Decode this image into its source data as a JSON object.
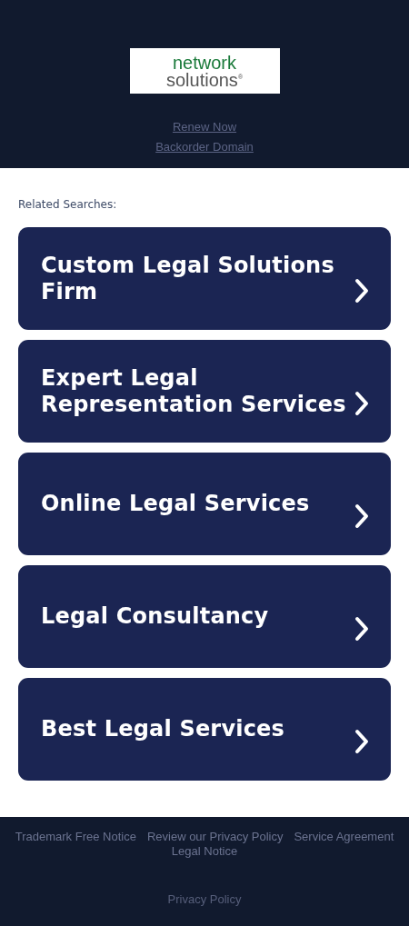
{
  "header": {
    "logo": {
      "line_1": "network",
      "line_2": "solutions$^{®}$"
    },
    "links": [
      "Renew Now",
      "Backorder Domain"
    ]
  },
  "related_searches": {
    "heading": "Related Searches:",
    "items": [
      {
        "label": "Custom Legal Solutions Firm"
      },
      {
        "label": "Expert Legal Representation Services"
      },
      {
        "label": "Online Legal Services"
      },
      {
        "label": "Legal Consultancy"
      },
      {
        "label": "Best Legal Services"
      }
    ]
  },
  "footer": {
    "links": [
      "Trademark Free Notice",
      "Review our Privacy Policy",
      "Service Agreement",
      "Legal Notice"
    ],
    "bottom_link": "Privacy Policy"
  }
}
